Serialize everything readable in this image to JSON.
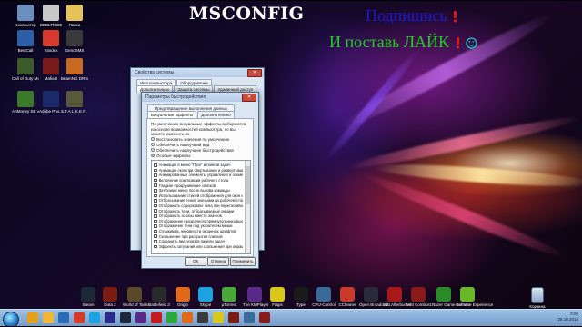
{
  "headline": {
    "title": "MSCONFIG",
    "line1": "Подпишись",
    "line2": "И поставь ЛАЙК"
  },
  "desktop_icons": [
    {
      "label": "Компьютер",
      "color": "#6a8fbf"
    },
    {
      "label": "BBBLTh888",
      "color": "#c8c8c8"
    },
    {
      "label": "Папка",
      "color": "#e6c25a"
    },
    {
      "label": "BestCall",
      "color": "#2b5fa8"
    },
    {
      "label": "Yandex",
      "color": "#d9382f"
    },
    {
      "label": "GenoSMS",
      "color": "#3a3a3a"
    },
    {
      "label": "Call of Duty Modern W...",
      "color": "#3d5a2a"
    },
    {
      "label": "Mafia II",
      "color": "#7a1a1a"
    },
    {
      "label": "BeamNG DRIVE",
      "color": "#c96a22"
    },
    {
      "label": "ArtMoney SE v7.40",
      "color": "#3a7a2a"
    },
    {
      "label": "Adobe Pho...",
      "color": "#1a2a6a"
    },
    {
      "label": "S.T.A.L.K.E.R. ОССЕ",
      "color": "#5a5a3a"
    }
  ],
  "sysconfig_window": {
    "title": "Свойства системы",
    "tabs_top": [
      "Имя компьютера",
      "Оборудование"
    ],
    "tabs_bottom": [
      "Дополнительно",
      "Защита системы",
      "Удаленный доступ"
    ]
  },
  "perf_dialog": {
    "title": "Параметры быстродействия",
    "tabs": [
      "Визуальные эффекты",
      "Дополнительно",
      "Предотвращение выполнения данных"
    ],
    "description": "По умолчанию визуальные эффекты выбираются на основе возможностей компьютера, но вы можете изменить их.",
    "radios": [
      {
        "label": "Восстановить значения по умолчанию",
        "checked": false
      },
      {
        "label": "Обеспечить наилучший вид",
        "checked": false
      },
      {
        "label": "Обеспечить наилучшее быстродействие",
        "checked": false
      },
      {
        "label": "Особые эффекты:",
        "checked": true
      }
    ],
    "effects": [
      {
        "label": "Анимация в меню \"Пуск\" и панели задач",
        "checked": false
      },
      {
        "label": "Анимация окон при свертывании и развертывании",
        "checked": false
      },
      {
        "label": "Анимированные элементы управления и элементы вну",
        "checked": false
      },
      {
        "label": "Включение композиции рабочего стола",
        "checked": true
      },
      {
        "label": "Гладкое прокручивание списков",
        "checked": false
      },
      {
        "label": "Затухание меню после вызова команды",
        "checked": false
      },
      {
        "label": "Использование стилей отображения для окон и кнопо",
        "checked": true
      },
      {
        "label": "Отбрасывание теней значками на рабочем столе",
        "checked": false
      },
      {
        "label": "Отображать содержимое окна при перетаскивании",
        "checked": true
      },
      {
        "label": "Отображать тени, отбрасываемые окнами",
        "checked": false
      },
      {
        "label": "Отображать эскизы вместо значков",
        "checked": true
      },
      {
        "label": "Отображение прозрачного прямоугольника выделени",
        "checked": true
      },
      {
        "label": "Отображение тени под указателем мыши",
        "checked": false
      },
      {
        "label": "Сглаживать неровности экранных шрифтов",
        "checked": true
      },
      {
        "label": "Скольжение при раскрытии списков",
        "checked": false
      },
      {
        "label": "Сохранить вид эскизов панели задач",
        "checked": false
      },
      {
        "label": "Эффекты затухания или скольжения при обращении к",
        "checked": false
      }
    ],
    "buttons": {
      "ok": "ОК",
      "cancel": "Отмена",
      "apply": "Применить"
    }
  },
  "dock": [
    {
      "label": "Steam",
      "color": "#1b2838"
    },
    {
      "label": "Dota 2",
      "color": "#7a1c12"
    },
    {
      "label": "World of Tanks",
      "color": "#5a4a2a"
    },
    {
      "label": "Battlefield 3",
      "color": "#2a2a2a"
    },
    {
      "label": "Origin",
      "color": "#e06a1a"
    },
    {
      "label": "Skype",
      "color": "#1aa3e0"
    },
    {
      "label": "µTorrent",
      "color": "#4aa83a"
    },
    {
      "label": "The KMPlayer",
      "color": "#5a2a8a"
    },
    {
      "label": "Fraps",
      "color": "#d8c81a"
    },
    {
      "label": "Tyрe",
      "color": "#1a1a1a"
    },
    {
      "label": "CPU-Control",
      "color": "#3a6a9a"
    },
    {
      "label": "CCleaner",
      "color": "#c83a2a"
    },
    {
      "label": "Open Broadcast...",
      "color": "#2a2a3a"
    },
    {
      "label": "MSI Afterburner",
      "color": "#a81a1a"
    },
    {
      "label": "MSI Kombust...",
      "color": "#8a1a1a"
    },
    {
      "label": "Razer Game Booster",
      "color": "#2a8a2a"
    },
    {
      "label": "GeForce Experience",
      "color": "#6ab82a"
    }
  ],
  "recycle_bin": {
    "label": "Корзина"
  },
  "taskbar": {
    "pinned": [
      {
        "color": "#e3a21a"
      },
      {
        "color": "#f2b632"
      },
      {
        "color": "#2a6ab8"
      },
      {
        "color": "#d83a2a"
      },
      {
        "color": "#1aa3e0"
      },
      {
        "color": "#2a2a8a"
      },
      {
        "color": "#1b2838"
      },
      {
        "color": "#5a2a8a"
      },
      {
        "color": "#c81a1a"
      },
      {
        "color": "#2aa83a"
      },
      {
        "color": "#e06a1a"
      },
      {
        "color": "#3a3a3a"
      },
      {
        "color": "#d8c81a"
      },
      {
        "color": "#7a1c12"
      },
      {
        "color": "#3a6a9a"
      },
      {
        "color": "#8a1a1a"
      }
    ],
    "time": "0:00",
    "date": "26.10.2014"
  }
}
